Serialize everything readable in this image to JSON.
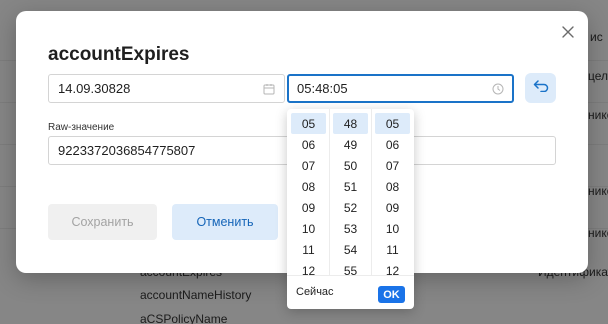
{
  "background": {
    "visible_texts": [
      {
        "text": "ис",
        "name": "bg-col-fragment-1"
      },
      {
        "text": "целс",
        "name": "bg-col-fragment-2"
      },
      {
        "text": "нико",
        "name": "bg-col-fragment-3"
      },
      {
        "text": "нико",
        "name": "bg-col-fragment-4"
      },
      {
        "text": "нико",
        "name": "bg-col-fragment-5"
      },
      {
        "text": "accountExpires",
        "name": "bg-row-account-expires"
      },
      {
        "text": "Идентификато",
        "name": "bg-col-fragment-6"
      },
      {
        "text": "accountNameHistory",
        "name": "bg-row-account-name-history"
      },
      {
        "text": "aCSPolicyName",
        "name": "bg-row-acs-policy-name"
      }
    ]
  },
  "modal": {
    "title": "accountExpires",
    "date_value": "14.09.30828",
    "time_value": "05:48:05",
    "raw_label": "Raw-значение",
    "raw_value": "9223372036854775807",
    "save_label": "Сохранить",
    "cancel_label": "Отменить",
    "icons": {
      "close": "close-icon",
      "calendar": "calendar-icon",
      "clock": "clock-icon",
      "reset": "undo-arrow-icon"
    }
  },
  "time_picker": {
    "hours": [
      "05",
      "06",
      "07",
      "08",
      "09",
      "10",
      "11",
      "12"
    ],
    "minutes": [
      "48",
      "49",
      "50",
      "51",
      "52",
      "53",
      "54",
      "55"
    ],
    "seconds": [
      "05",
      "06",
      "07",
      "08",
      "09",
      "10",
      "11",
      "12"
    ],
    "selected": {
      "hour": "05",
      "minute": "48",
      "second": "05"
    },
    "now_label": "Сейчас",
    "ok_label": "OK"
  },
  "colors": {
    "accent": "#1a73e8",
    "accent_light": "#ddebfa",
    "disabled_bg": "#f0f0f0",
    "disabled_text": "#a3a3a3"
  }
}
